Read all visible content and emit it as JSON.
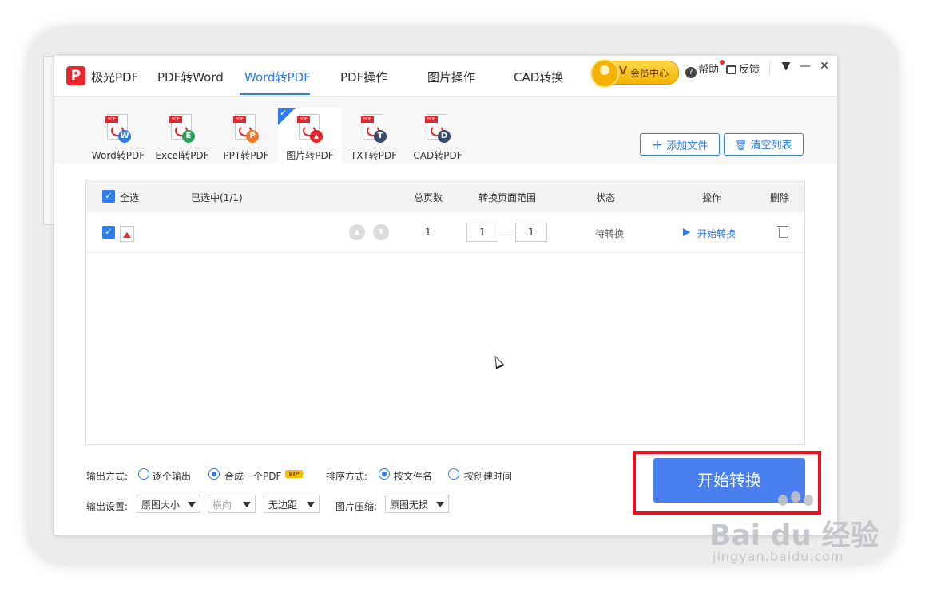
{
  "app": {
    "logo_letter": "P",
    "name": "极光PDF",
    "nav_tabs": [
      {
        "label": "PDF转Word"
      },
      {
        "label": "Word转PDF",
        "active": true
      },
      {
        "label": "PDF操作"
      },
      {
        "label": "图片操作"
      },
      {
        "label": "CAD转换"
      }
    ],
    "vip": {
      "letter": "V",
      "label": "会员中心"
    },
    "help_label": "帮助",
    "feedback_label": "反馈",
    "window_controls": {
      "menu": "▼",
      "minimize": "—",
      "close": "✕"
    }
  },
  "tools": [
    {
      "label": "Word转PDF",
      "badge": "W",
      "badge_color": "#2d7cf0"
    },
    {
      "label": "Excel转PDF",
      "badge": "E",
      "badge_color": "#2aa35a"
    },
    {
      "label": "PPT转PDF",
      "badge": "P",
      "badge_color": "#f07a2d"
    },
    {
      "label": "图片转PDF",
      "badge": "▲",
      "badge_color": "#e8262b",
      "active": true
    },
    {
      "label": "TXT转PDF",
      "badge": "T",
      "badge_color": "#3a4a6b"
    },
    {
      "label": "CAD转PDF",
      "badge": "D",
      "badge_color": "#3a4a6b"
    }
  ],
  "actions": {
    "add_files": "添加文件",
    "add_icon": "+",
    "clear_list": "清空列表",
    "clear_icon": "🗑"
  },
  "table": {
    "select_all": "全选",
    "headers": {
      "selected": "已选中(1/1)",
      "total_pages": "总页数",
      "range": "转换页面范围",
      "status": "状态",
      "operation": "操作",
      "delete": "删除"
    },
    "rows": [
      {
        "pages": "1",
        "range_from": "1",
        "range_to": "1",
        "status": "待转换",
        "action": "开始转换"
      }
    ]
  },
  "settings": {
    "output_mode_label": "输出方式:",
    "output_modes": [
      {
        "label": "逐个输出",
        "selected": false
      },
      {
        "label": "合成一个PDF",
        "selected": true
      }
    ],
    "vip_tag": "VIP",
    "sort_label": "排序方式:",
    "sort_modes": [
      {
        "label": "按文件名",
        "selected": true
      },
      {
        "label": "按创建时间",
        "selected": false
      }
    ],
    "output_settings_label": "输出设置:",
    "size_value": "原图大小",
    "orientation_value": "横向",
    "margin_value": "无边距",
    "compress_label": "图片压缩:",
    "compress_value": "原图无损"
  },
  "start_button": "开始转换",
  "watermark": {
    "main": "Bai du 经验",
    "sub": "jingyan.baidu.com"
  },
  "colors": {
    "accent": "#2d7cf0",
    "brand_red": "#e8262b",
    "start_button": "#4a7ff0",
    "highlight": "#e8101a"
  }
}
